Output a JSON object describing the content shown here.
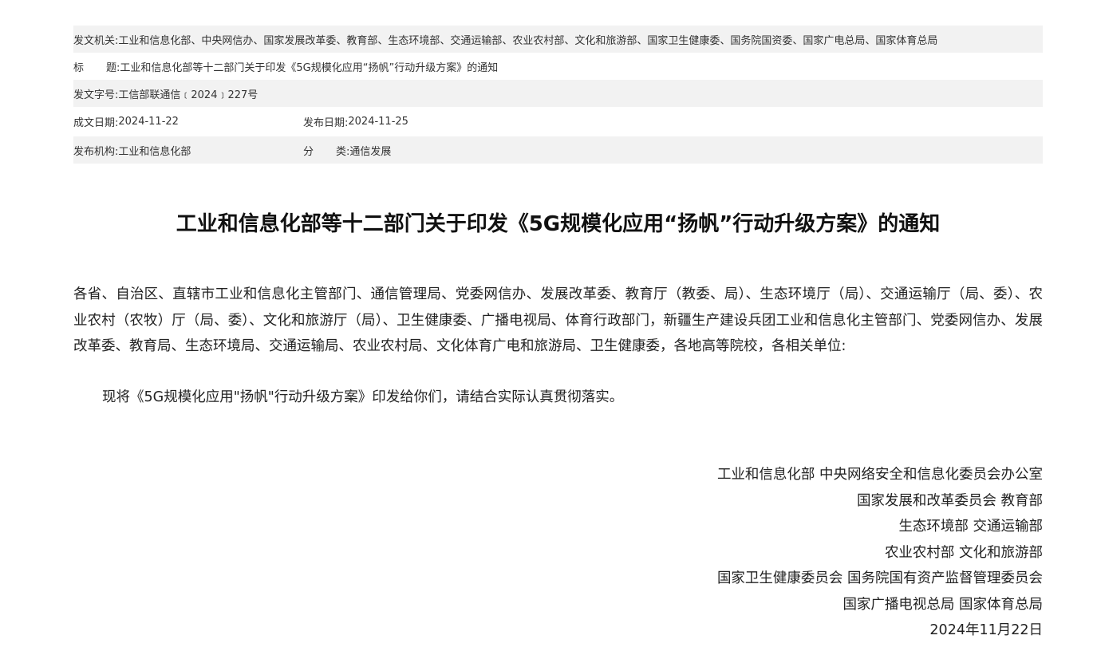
{
  "meta": {
    "issuer_label": "发文机关:",
    "issuer_value": "工业和信息化部、中央网信办、国家发展改革委、教育部、生态环境部、交通运输部、农业农村部、文化和旅游部、国家卫生健康委、国务院国资委、国家广电总局、国家体育总局",
    "title_label_a": "标",
    "title_label_b": "题:",
    "title_value": "工业和信息化部等十二部门关于印发《5G规模化应用“扬帆”行动升级方案》的通知",
    "doc_number_label": "发文字号:",
    "doc_number_value": "工信部联通信﹝2024﹞227号",
    "written_date_label": "成文日期:",
    "written_date_value": "2024-11-22",
    "publish_date_label": "发布日期:",
    "publish_date_value": "2024-11-25",
    "org_label": "发布机构:",
    "org_value": "工业和信息化部",
    "category_label_a": "分",
    "category_label_b": "类:",
    "category_value": "通信发展"
  },
  "document": {
    "title": "工业和信息化部等十二部门关于印发《5G规模化应用“扬帆”行动升级方案》的通知",
    "salutation": "各省、自治区、直辖市工业和信息化主管部门、通信管理局、党委网信办、发展改革委、教育厅（教委、局）、生态环境厅（局）、交通运输厅（局、委）、农业农村（农牧）厅（局、委）、文化和旅游厅（局）、卫生健康委、广播电视局、体育行政部门，新疆生产建设兵团工业和信息化主管部门、党委网信办、发展改革委、教育局、生态环境局、交通运输局、农业农村局、文化体育广电和旅游局、卫生健康委，各地高等院校，各相关单位:",
    "content": "现将《5G规模化应用\"扬帆\"行动升级方案》印发给你们，请结合实际认真贯彻落实。",
    "signatures": [
      "工业和信息化部  中央网络安全和信息化委员会办公室",
      "国家发展和改革委员会 教育部",
      "生态环境部 交通运输部",
      "农业农村部 文化和旅游部",
      "国家卫生健康委员会 国务院国有资产监督管理委员会",
      "国家广播电视总局 国家体育总局"
    ],
    "date": "2024年11月22日"
  }
}
